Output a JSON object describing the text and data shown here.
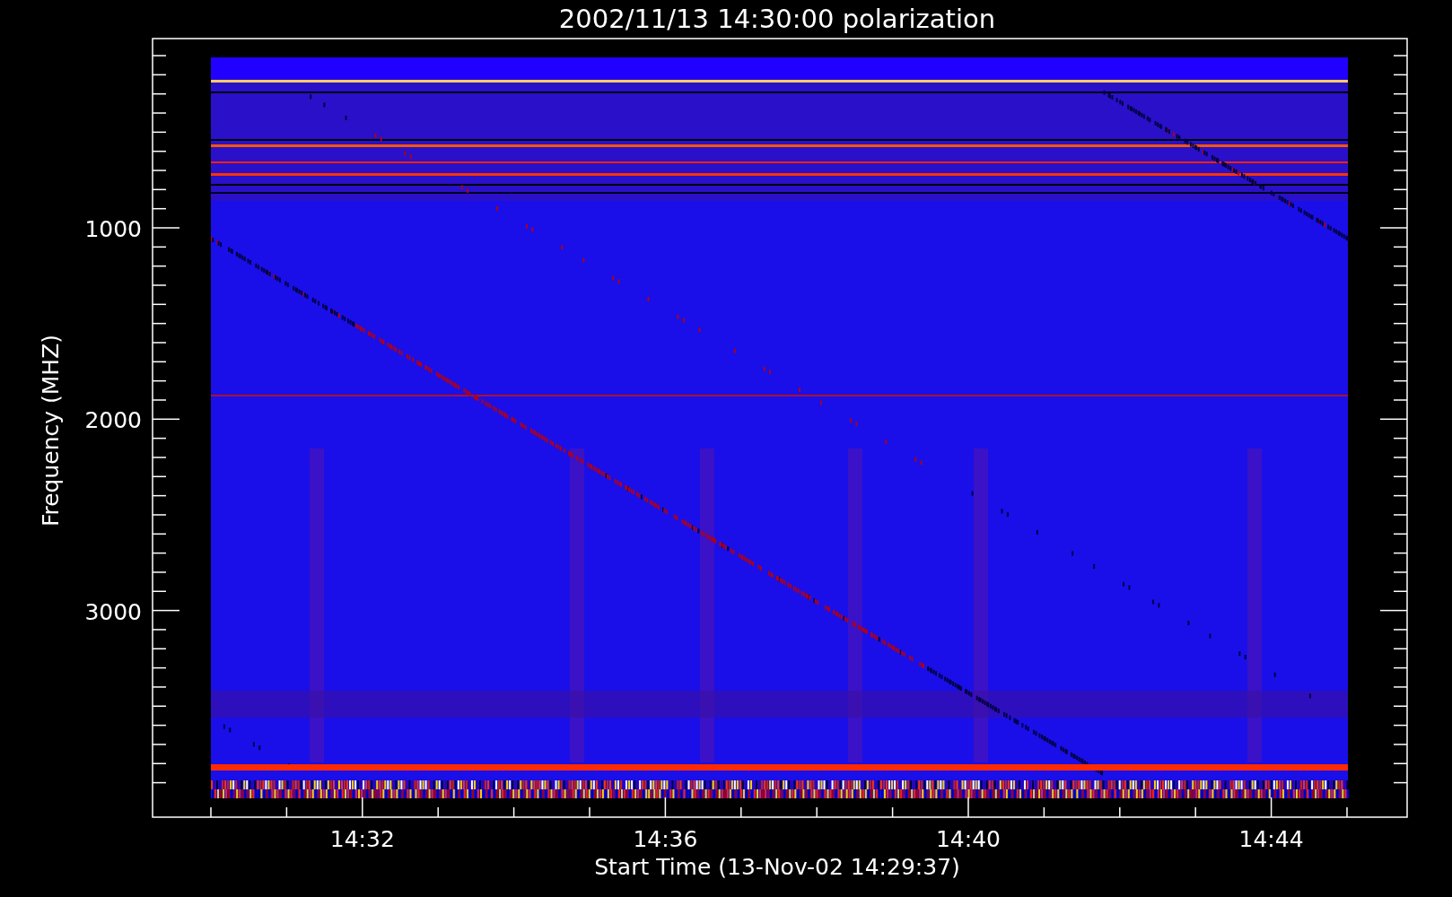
{
  "plot": {
    "title": "2002/11/13 14:30:00 polarization",
    "xlabel": "Start Time (13-Nov-02 14:29:37)",
    "ylabel": "Frequency (MHZ)",
    "yticks": [
      "1000",
      "2000",
      "3000"
    ],
    "xticks": [
      "14:32",
      "14:36",
      "14:40",
      "14:44"
    ]
  }
}
